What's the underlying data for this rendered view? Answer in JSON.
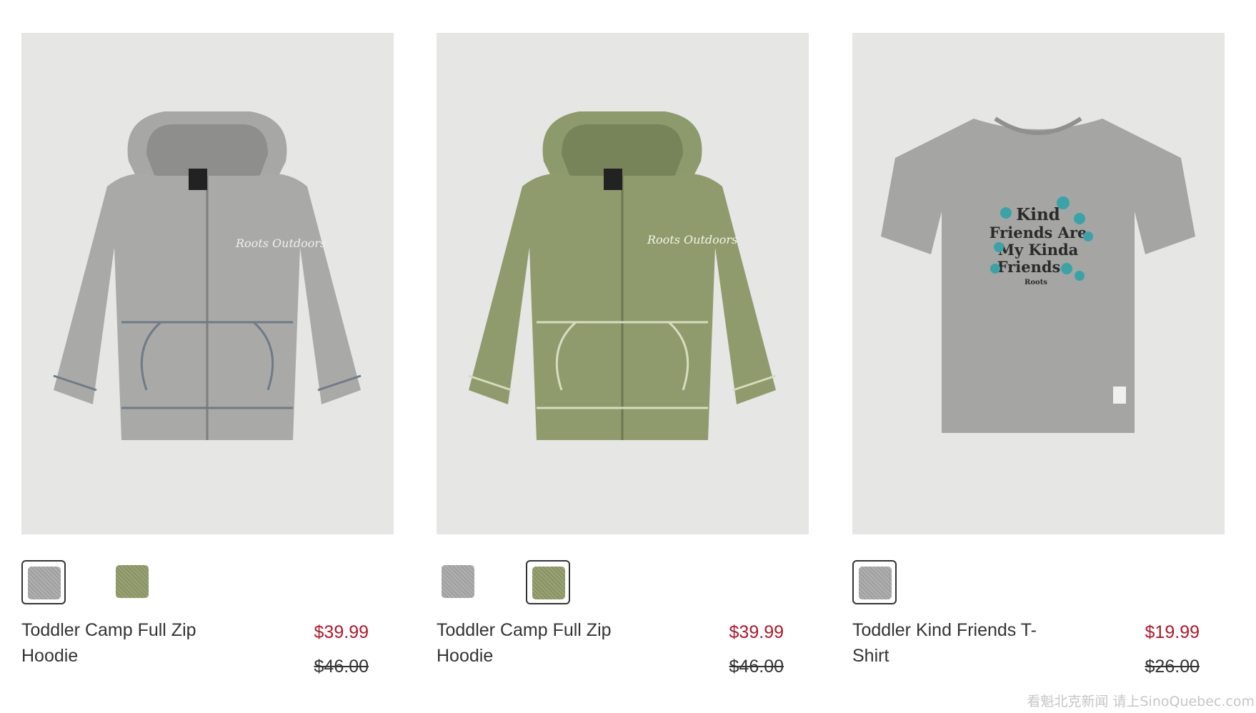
{
  "products": [
    {
      "name": "Toddler Camp Full Zip Hoodie",
      "sale_price": "$39.99",
      "original_price": "$46.00",
      "image_color": "#a8a8a6",
      "swatches": [
        {
          "color": "#a8a8a8",
          "selected": true
        },
        {
          "color": "#8f9a68",
          "selected": false
        }
      ]
    },
    {
      "name": "Toddler Camp Full Zip Hoodie",
      "sale_price": "$39.99",
      "original_price": "$46.00",
      "image_color": "#8e9a6c",
      "swatches": [
        {
          "color": "#a8a8a8",
          "selected": false
        },
        {
          "color": "#8f9a68",
          "selected": true
        }
      ]
    },
    {
      "name": "Toddler Kind Friends T-Shirt",
      "sale_price": "$19.99",
      "original_price": "$26.00",
      "image_color": "#a4a4a4",
      "graphic_text": [
        "Kind",
        "Friends Are",
        "My Kinda",
        "Friends",
        "Roots"
      ],
      "swatches": [
        {
          "color": "#a8a8a8",
          "selected": true
        }
      ]
    }
  ],
  "watermark": "看魁北克新闻 请上SinoQuebec.com"
}
